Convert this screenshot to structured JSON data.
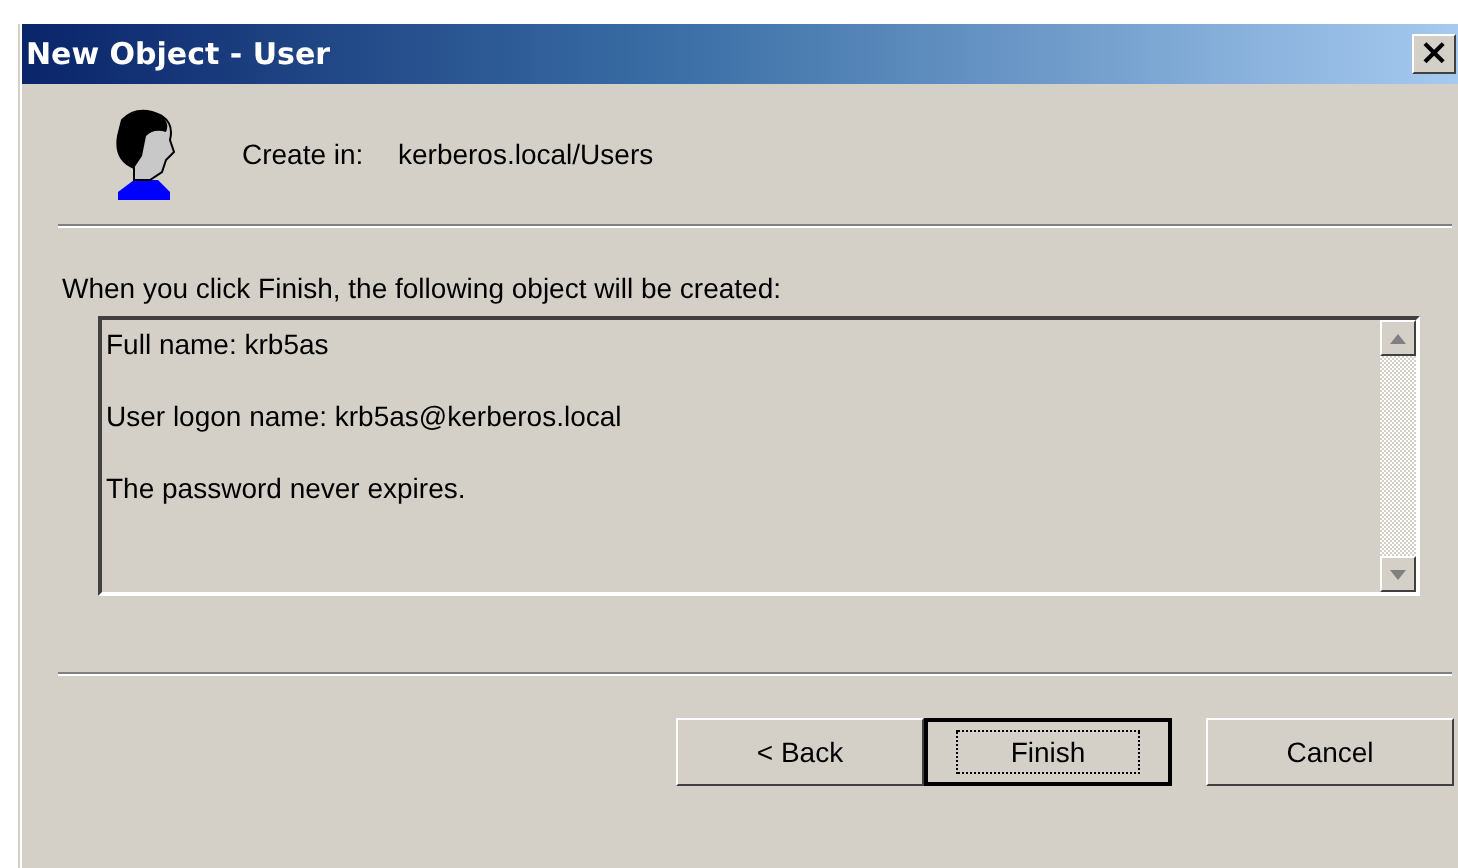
{
  "window": {
    "title": "New Object - User",
    "close": "×"
  },
  "create_in": {
    "label": "Create in:",
    "value": "kerberos.local/Users"
  },
  "intro": "When you click Finish, the following object will be created:",
  "summary": [
    "Full name: krb5as",
    "User logon name: krb5as@kerberos.local",
    "The password never expires."
  ],
  "buttons": [
    {
      "label": "< Back",
      "default": false
    },
    {
      "label": "Finish",
      "default": true
    },
    {
      "label": "Cancel",
      "default": false
    }
  ]
}
